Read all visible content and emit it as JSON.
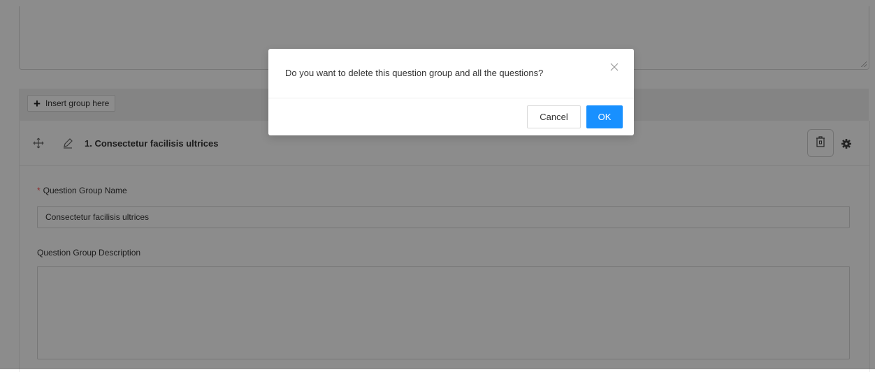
{
  "insert_bar": {
    "button_label": "Insert group here",
    "icon": "plus-icon"
  },
  "group": {
    "title": "1. Consectetur facilisis ultrices",
    "icons": [
      "move-icon",
      "edit-icon",
      "delete-icon",
      "gear-icon"
    ],
    "name_label": "Question Group Name",
    "name_value": "Consectetur facilisis ultrices",
    "description_label": "Question Group Description",
    "description_value": ""
  },
  "modal": {
    "message": "Do you want to delete this question group and all the questions?",
    "cancel_label": "Cancel",
    "ok_label": "OK",
    "close_icon": "close-icon"
  },
  "colors": {
    "primary": "#1890ff",
    "required": "#ff4d4f",
    "overlay": "rgba(0,0,0,0.45)"
  }
}
